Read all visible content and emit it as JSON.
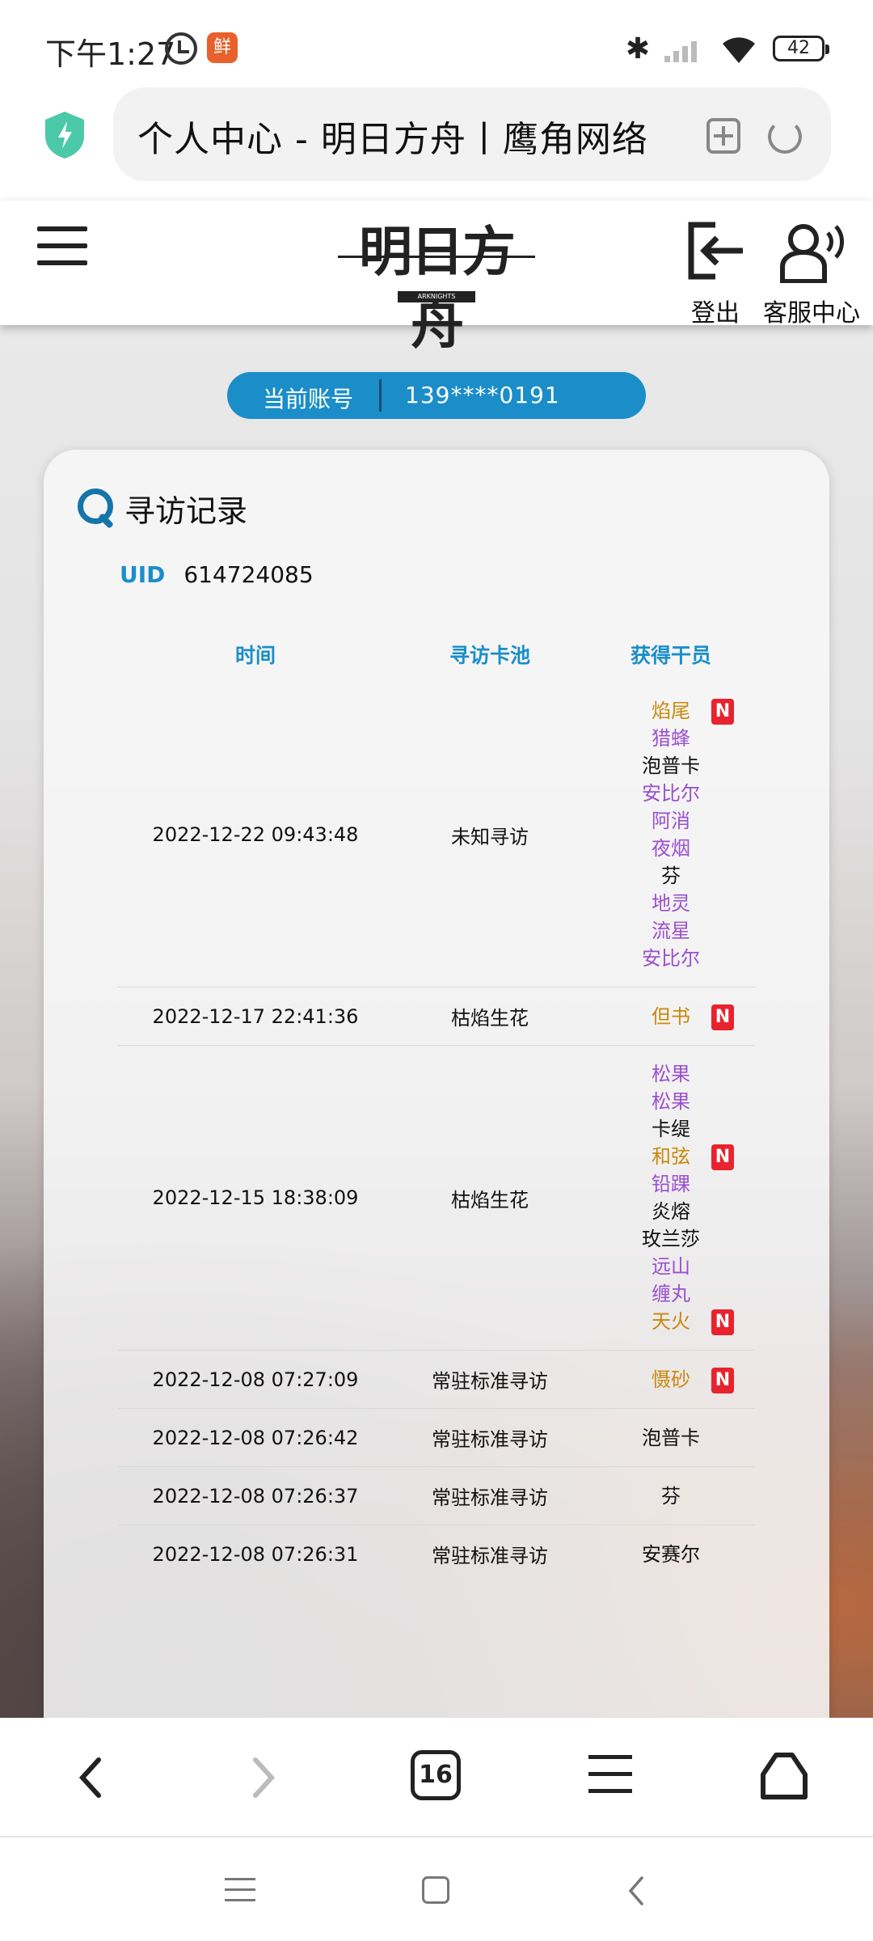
{
  "status_bar": {
    "time": "下午1:27",
    "app_badge": "鲜",
    "battery": "42"
  },
  "browser": {
    "page_title": "个人中心 - 明日方舟丨鹰角网络",
    "open_tabs": "16"
  },
  "site_header": {
    "logo_text": "明日方舟",
    "logo_subtext": "ARKNIGHTS",
    "logout_label": "登出",
    "service_label": "客服中心"
  },
  "account": {
    "label": "当前账号",
    "value": "139****0191"
  },
  "record": {
    "title": "寻访记录",
    "uid_label": "UID",
    "uid_value": "614724085",
    "columns": [
      "时间",
      "寻访卡池",
      "获得干员"
    ],
    "rows": [
      {
        "time": "2022-12-22 09:43:48",
        "pool": "未知寻访",
        "operators": [
          {
            "name": "焰尾",
            "rarity": 5,
            "new": true
          },
          {
            "name": "猎蜂",
            "rarity": 4,
            "new": false
          },
          {
            "name": "泡普卡",
            "rarity": 3,
            "new": false
          },
          {
            "name": "安比尔",
            "rarity": 4,
            "new": false
          },
          {
            "name": "阿消",
            "rarity": 4,
            "new": false
          },
          {
            "name": "夜烟",
            "rarity": 4,
            "new": false
          },
          {
            "name": "芬",
            "rarity": 3,
            "new": false
          },
          {
            "name": "地灵",
            "rarity": 4,
            "new": false
          },
          {
            "name": "流星",
            "rarity": 4,
            "new": false
          },
          {
            "name": "安比尔",
            "rarity": 4,
            "new": false
          }
        ]
      },
      {
        "time": "2022-12-17 22:41:36",
        "pool": "枯焰生花",
        "operators": [
          {
            "name": "但书",
            "rarity": 5,
            "new": true
          }
        ]
      },
      {
        "time": "2022-12-15 18:38:09",
        "pool": "枯焰生花",
        "operators": [
          {
            "name": "松果",
            "rarity": 4,
            "new": false
          },
          {
            "name": "松果",
            "rarity": 4,
            "new": false
          },
          {
            "name": "卡缇",
            "rarity": 3,
            "new": false
          },
          {
            "name": "和弦",
            "rarity": 5,
            "new": true
          },
          {
            "name": "铅踝",
            "rarity": 4,
            "new": false
          },
          {
            "name": "炎熔",
            "rarity": 3,
            "new": false
          },
          {
            "name": "玫兰莎",
            "rarity": 3,
            "new": false
          },
          {
            "name": "远山",
            "rarity": 4,
            "new": false
          },
          {
            "name": "缠丸",
            "rarity": 4,
            "new": false
          },
          {
            "name": "天火",
            "rarity": 5,
            "new": true
          }
        ]
      },
      {
        "time": "2022-12-08 07:27:09",
        "pool": "常驻标准寻访",
        "operators": [
          {
            "name": "慑砂",
            "rarity": 5,
            "new": true
          }
        ]
      },
      {
        "time": "2022-12-08 07:26:42",
        "pool": "常驻标准寻访",
        "operators": [
          {
            "name": "泡普卡",
            "rarity": 3,
            "new": false
          }
        ]
      },
      {
        "time": "2022-12-08 07:26:37",
        "pool": "常驻标准寻访",
        "operators": [
          {
            "name": "芬",
            "rarity": 3,
            "new": false
          }
        ]
      },
      {
        "time": "2022-12-08 07:26:31",
        "pool": "常驻标准寻访",
        "operators": [
          {
            "name": "安赛尔",
            "rarity": 3,
            "new": false
          }
        ]
      }
    ],
    "new_badge": "N"
  },
  "colors": {
    "accent_blue": "#1b8ec9",
    "rarity_5": "#c9880c",
    "rarity_4": "#9b4fd0",
    "rarity_3": "#111111",
    "new_badge": "#e8232e"
  },
  "icons": {
    "status": [
      "alarm-icon",
      "bluetooth-icon",
      "signal-icon",
      "wifi-icon",
      "battery-icon"
    ],
    "browser": [
      "shield-icon",
      "add-tab-icon",
      "reload-icon"
    ],
    "header": [
      "menu-icon",
      "logout-icon",
      "customer-service-icon"
    ],
    "bottom": [
      "back-icon",
      "forward-icon",
      "tabs-icon",
      "menu-icon",
      "home-icon"
    ]
  }
}
